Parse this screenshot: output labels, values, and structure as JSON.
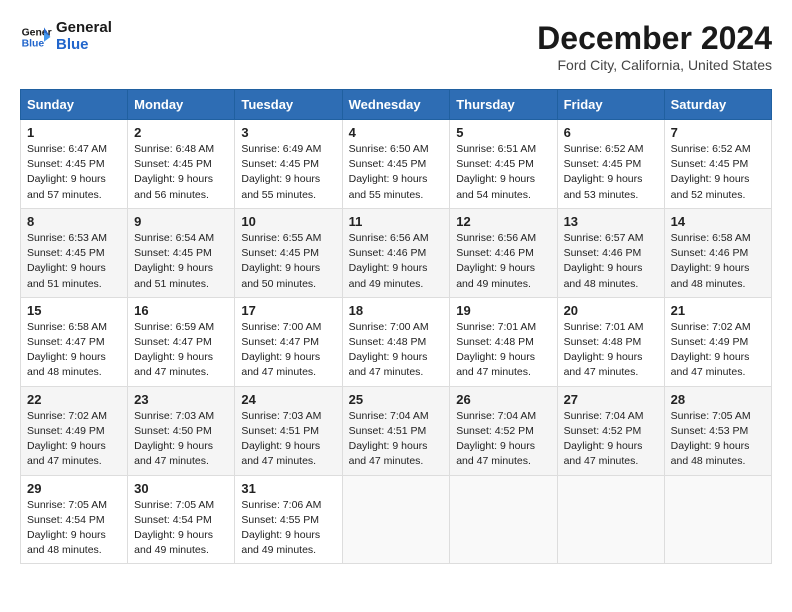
{
  "header": {
    "logo_line1": "General",
    "logo_line2": "Blue",
    "month": "December 2024",
    "location": "Ford City, California, United States"
  },
  "weekdays": [
    "Sunday",
    "Monday",
    "Tuesday",
    "Wednesday",
    "Thursday",
    "Friday",
    "Saturday"
  ],
  "weeks": [
    [
      {
        "day": "1",
        "sunrise": "6:47 AM",
        "sunset": "4:45 PM",
        "daylight": "9 hours and 57 minutes."
      },
      {
        "day": "2",
        "sunrise": "6:48 AM",
        "sunset": "4:45 PM",
        "daylight": "9 hours and 56 minutes."
      },
      {
        "day": "3",
        "sunrise": "6:49 AM",
        "sunset": "4:45 PM",
        "daylight": "9 hours and 55 minutes."
      },
      {
        "day": "4",
        "sunrise": "6:50 AM",
        "sunset": "4:45 PM",
        "daylight": "9 hours and 55 minutes."
      },
      {
        "day": "5",
        "sunrise": "6:51 AM",
        "sunset": "4:45 PM",
        "daylight": "9 hours and 54 minutes."
      },
      {
        "day": "6",
        "sunrise": "6:52 AM",
        "sunset": "4:45 PM",
        "daylight": "9 hours and 53 minutes."
      },
      {
        "day": "7",
        "sunrise": "6:52 AM",
        "sunset": "4:45 PM",
        "daylight": "9 hours and 52 minutes."
      }
    ],
    [
      {
        "day": "8",
        "sunrise": "6:53 AM",
        "sunset": "4:45 PM",
        "daylight": "9 hours and 51 minutes."
      },
      {
        "day": "9",
        "sunrise": "6:54 AM",
        "sunset": "4:45 PM",
        "daylight": "9 hours and 51 minutes."
      },
      {
        "day": "10",
        "sunrise": "6:55 AM",
        "sunset": "4:45 PM",
        "daylight": "9 hours and 50 minutes."
      },
      {
        "day": "11",
        "sunrise": "6:56 AM",
        "sunset": "4:46 PM",
        "daylight": "9 hours and 49 minutes."
      },
      {
        "day": "12",
        "sunrise": "6:56 AM",
        "sunset": "4:46 PM",
        "daylight": "9 hours and 49 minutes."
      },
      {
        "day": "13",
        "sunrise": "6:57 AM",
        "sunset": "4:46 PM",
        "daylight": "9 hours and 48 minutes."
      },
      {
        "day": "14",
        "sunrise": "6:58 AM",
        "sunset": "4:46 PM",
        "daylight": "9 hours and 48 minutes."
      }
    ],
    [
      {
        "day": "15",
        "sunrise": "6:58 AM",
        "sunset": "4:47 PM",
        "daylight": "9 hours and 48 minutes."
      },
      {
        "day": "16",
        "sunrise": "6:59 AM",
        "sunset": "4:47 PM",
        "daylight": "9 hours and 47 minutes."
      },
      {
        "day": "17",
        "sunrise": "7:00 AM",
        "sunset": "4:47 PM",
        "daylight": "9 hours and 47 minutes."
      },
      {
        "day": "18",
        "sunrise": "7:00 AM",
        "sunset": "4:48 PM",
        "daylight": "9 hours and 47 minutes."
      },
      {
        "day": "19",
        "sunrise": "7:01 AM",
        "sunset": "4:48 PM",
        "daylight": "9 hours and 47 minutes."
      },
      {
        "day": "20",
        "sunrise": "7:01 AM",
        "sunset": "4:48 PM",
        "daylight": "9 hours and 47 minutes."
      },
      {
        "day": "21",
        "sunrise": "7:02 AM",
        "sunset": "4:49 PM",
        "daylight": "9 hours and 47 minutes."
      }
    ],
    [
      {
        "day": "22",
        "sunrise": "7:02 AM",
        "sunset": "4:49 PM",
        "daylight": "9 hours and 47 minutes."
      },
      {
        "day": "23",
        "sunrise": "7:03 AM",
        "sunset": "4:50 PM",
        "daylight": "9 hours and 47 minutes."
      },
      {
        "day": "24",
        "sunrise": "7:03 AM",
        "sunset": "4:51 PM",
        "daylight": "9 hours and 47 minutes."
      },
      {
        "day": "25",
        "sunrise": "7:04 AM",
        "sunset": "4:51 PM",
        "daylight": "9 hours and 47 minutes."
      },
      {
        "day": "26",
        "sunrise": "7:04 AM",
        "sunset": "4:52 PM",
        "daylight": "9 hours and 47 minutes."
      },
      {
        "day": "27",
        "sunrise": "7:04 AM",
        "sunset": "4:52 PM",
        "daylight": "9 hours and 47 minutes."
      },
      {
        "day": "28",
        "sunrise": "7:05 AM",
        "sunset": "4:53 PM",
        "daylight": "9 hours and 48 minutes."
      }
    ],
    [
      {
        "day": "29",
        "sunrise": "7:05 AM",
        "sunset": "4:54 PM",
        "daylight": "9 hours and 48 minutes."
      },
      {
        "day": "30",
        "sunrise": "7:05 AM",
        "sunset": "4:54 PM",
        "daylight": "9 hours and 49 minutes."
      },
      {
        "day": "31",
        "sunrise": "7:06 AM",
        "sunset": "4:55 PM",
        "daylight": "9 hours and 49 minutes."
      },
      null,
      null,
      null,
      null
    ]
  ]
}
